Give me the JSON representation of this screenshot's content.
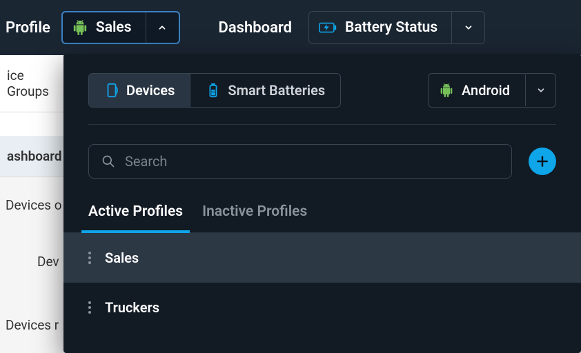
{
  "topbar": {
    "profile_label": "Profile",
    "profile_value": "Sales",
    "dashboard_label": "Dashboard",
    "dashboard_value": "Battery Status"
  },
  "background": {
    "tab1": "ice Groups",
    "tab2": "ashboard",
    "text1": "Devices o",
    "text2": "Dev",
    "text3": "Devices r"
  },
  "panel": {
    "segments": {
      "devices": "Devices",
      "smart_batteries": "Smart Batteries"
    },
    "os_dropdown": "Android",
    "search_placeholder": "Search",
    "tabs": {
      "active": "Active Profiles",
      "inactive": "Inactive Profiles"
    },
    "profiles": [
      {
        "name": "Sales",
        "selected": true
      },
      {
        "name": "Truckers",
        "selected": false
      }
    ]
  },
  "colors": {
    "accent": "#0ea5e9",
    "android": "#77c159"
  }
}
